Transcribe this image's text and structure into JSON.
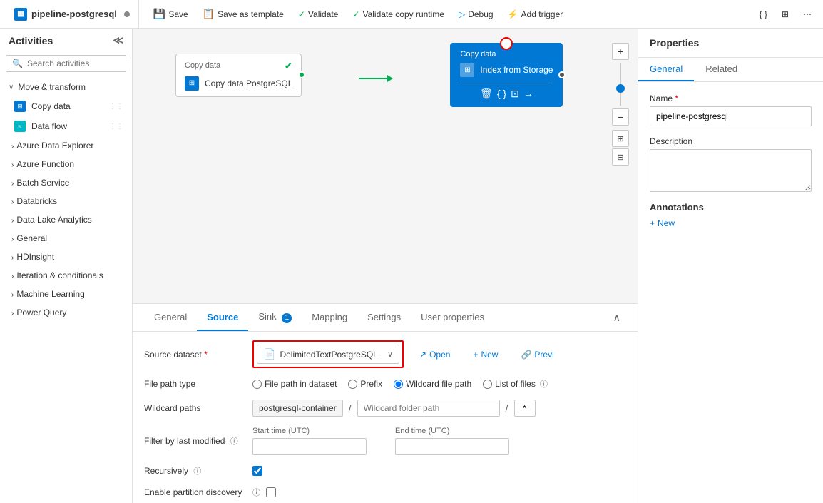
{
  "window": {
    "title": "pipeline-postgresql"
  },
  "toolbar": {
    "save_label": "Save",
    "save_as_template_label": "Save as template",
    "validate_label": "Validate",
    "validate_copy_runtime_label": "Validate copy runtime",
    "debug_label": "Debug",
    "add_trigger_label": "Add trigger"
  },
  "sidebar": {
    "title": "Activities",
    "search_placeholder": "Search activities",
    "sections": [
      {
        "name": "move-transform",
        "label": "Move & transform",
        "expanded": true,
        "items": [
          {
            "name": "copy-data",
            "label": "Copy data",
            "icon": "copy"
          },
          {
            "name": "data-flow",
            "label": "Data flow",
            "icon": "flow"
          }
        ]
      },
      {
        "name": "azure-data-explorer",
        "label": "Azure Data Explorer",
        "expanded": false,
        "items": []
      },
      {
        "name": "azure-function",
        "label": "Azure Function",
        "expanded": false,
        "items": []
      },
      {
        "name": "batch-service",
        "label": "Batch Service",
        "expanded": false,
        "items": []
      },
      {
        "name": "databricks",
        "label": "Databricks",
        "expanded": false,
        "items": []
      },
      {
        "name": "data-lake-analytics",
        "label": "Data Lake Analytics",
        "expanded": false,
        "items": []
      },
      {
        "name": "general",
        "label": "General",
        "expanded": false,
        "items": []
      },
      {
        "name": "hdinsight",
        "label": "HDInsight",
        "expanded": false,
        "items": []
      },
      {
        "name": "iteration-conditionals",
        "label": "Iteration & conditionals",
        "expanded": false,
        "items": []
      },
      {
        "name": "machine-learning",
        "label": "Machine Learning",
        "expanded": false,
        "items": []
      },
      {
        "name": "power-query",
        "label": "Power Query",
        "expanded": false,
        "items": []
      }
    ]
  },
  "canvas": {
    "nodes": [
      {
        "id": "node1",
        "type": "copy-data",
        "label": "Copy data",
        "sublabel": "Copy data PostgreSQL",
        "active": false,
        "success": true
      },
      {
        "id": "node2",
        "type": "copy-data",
        "label": "Copy data",
        "sublabel": "Index from Storage",
        "active": true,
        "success": false
      }
    ]
  },
  "bottom_panel": {
    "tabs": [
      {
        "name": "general",
        "label": "General",
        "active": false,
        "badge": null
      },
      {
        "name": "source",
        "label": "Source",
        "active": true,
        "badge": null
      },
      {
        "name": "sink",
        "label": "Sink",
        "active": false,
        "badge": "1"
      },
      {
        "name": "mapping",
        "label": "Mapping",
        "active": false,
        "badge": null
      },
      {
        "name": "settings",
        "label": "Settings",
        "active": false,
        "badge": null
      },
      {
        "name": "user-properties",
        "label": "User properties",
        "active": false,
        "badge": null
      }
    ],
    "source": {
      "dataset_label": "Source dataset",
      "dataset_required": "*",
      "dataset_value": "DelimitedTextPostgreSQL",
      "open_label": "Open",
      "new_label": "New",
      "preview_label": "Previ",
      "file_path_type_label": "File path type",
      "file_path_options": [
        {
          "value": "file-path-in-dataset",
          "label": "File path in dataset"
        },
        {
          "value": "prefix",
          "label": "Prefix"
        },
        {
          "value": "wildcard-file-path",
          "label": "Wildcard file path",
          "checked": true
        },
        {
          "value": "list-of-files",
          "label": "List of files"
        }
      ],
      "wildcard_paths_label": "Wildcard paths",
      "wildcard_container": "postgresql-container",
      "wildcard_folder_placeholder": "Wildcard folder path",
      "wildcard_file_value": "*",
      "filter_label": "Filter by last modified",
      "start_time_label": "Start time (UTC)",
      "end_time_label": "End time (UTC)",
      "start_time_value": "",
      "end_time_value": "",
      "recursively_label": "Recursively",
      "recursively_checked": true,
      "partition_label": "Enable partition discovery"
    }
  },
  "properties": {
    "title": "Properties",
    "tabs": [
      {
        "name": "general",
        "label": "General",
        "active": true
      },
      {
        "name": "related",
        "label": "Related",
        "active": false
      }
    ],
    "name_label": "Name",
    "name_required": "*",
    "name_value": "pipeline-postgresql",
    "description_label": "Description",
    "description_value": "",
    "annotations_label": "Annotations",
    "new_annotation_label": "New"
  }
}
